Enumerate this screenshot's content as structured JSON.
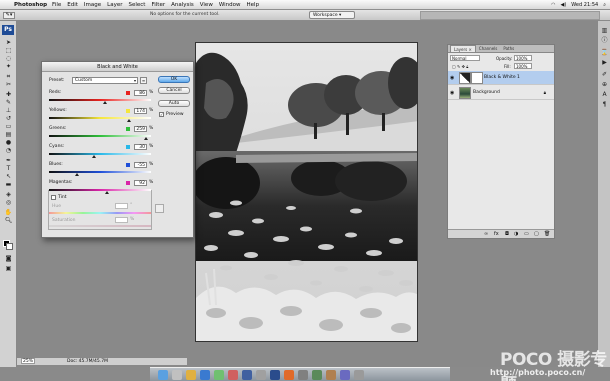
{
  "menubar": {
    "apple": "",
    "app_name": "Photoshop",
    "items": [
      "File",
      "Edit",
      "Image",
      "Layer",
      "Select",
      "Filter",
      "Analysis",
      "View",
      "Window",
      "Help"
    ],
    "clock": "Wed 21:54"
  },
  "options_bar": {
    "hint": "No options for the current tool.",
    "workspace": "Workspace ▾"
  },
  "dialog": {
    "title": "Black and White",
    "preset_label": "Preset:",
    "preset_value": "Custom",
    "buttons": {
      "ok": "OK",
      "cancel": "Cancel",
      "auto": "Auto"
    },
    "preview_label": "Preview",
    "preview_checked": true,
    "sliders": [
      {
        "label": "Reds:",
        "value": "86",
        "unit": "%",
        "color": "#e8231f",
        "position": 0.55
      },
      {
        "label": "Yellows:",
        "value": "174",
        "unit": "%",
        "color": "#f5e63a",
        "position": 0.78
      },
      {
        "label": "Greens:",
        "value": "259",
        "unit": "%",
        "color": "#2fbf3a",
        "position": 0.95
      },
      {
        "label": "Cyans:",
        "value": "30",
        "unit": "%",
        "color": "#29b8e8",
        "position": 0.44
      },
      {
        "label": "Blues:",
        "value": "-55",
        "unit": "%",
        "color": "#1f4fd8",
        "position": 0.27
      },
      {
        "label": "Magentas:",
        "value": "92",
        "unit": "%",
        "color": "#d925a8",
        "position": 0.57
      }
    ],
    "tint": {
      "label": "Tint",
      "hue_label": "Hue",
      "hue_unit": "°",
      "saturation_label": "Saturation",
      "saturation_unit": "%"
    }
  },
  "layers_panel": {
    "tabs": [
      "Layers ×",
      "Channels",
      "Paths"
    ],
    "blend_mode": "Normal",
    "opacity_label": "Opacity:",
    "opacity_value": "100%",
    "fill_label": "Fill:",
    "fill_value": "100%",
    "layers": [
      {
        "name": "Black & White 1",
        "selected": true
      },
      {
        "name": "Background",
        "selected": false
      }
    ]
  },
  "statusbar": {
    "zoom": "25%",
    "doc": "Doc: 45.7M/45.7M"
  },
  "watermark": {
    "logo": "POCO 摄影专题",
    "url": "http://photo.poco.cn/"
  }
}
